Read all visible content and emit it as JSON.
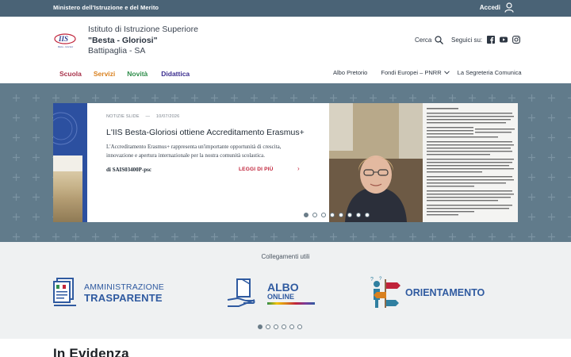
{
  "topbar": {
    "ministry": "Ministero dell'Istruzione e del Merito",
    "login_label": "Accedi"
  },
  "header": {
    "logo_text": "IIS",
    "logo_subtext": "Besta - Gloriosi",
    "school_line1": "Istituto di Istruzione Superiore",
    "school_line2": "\"Besta - Gloriosi\"",
    "school_line3": "Battipaglia - SA",
    "search_label": "Cerca",
    "social_label": "Seguici su:"
  },
  "nav": {
    "left": [
      {
        "label": "Scuola",
        "color": "#a8324a"
      },
      {
        "label": "Servizi",
        "color": "#d9801e"
      },
      {
        "label": "Novità",
        "color": "#2e8d4a"
      },
      {
        "label": "Didattica",
        "color": "#3a2d8f"
      }
    ],
    "right": [
      {
        "label": "Albo Pretorio"
      },
      {
        "label": "Fondi Europei – PNRR"
      },
      {
        "label": "La Segreteria Comunica"
      }
    ]
  },
  "hero": {
    "category": "NOTIZIE SLIDE",
    "separator": "—",
    "date": "10/07/2026",
    "title": "L'IIS Besta-Gloriosi ottiene Accreditamento Erasmus+",
    "text": "L'Accreditamento Erasmus+ rappresenta un'importante opportunità di crescita, innovazione e apertura internazionale per la nostra comunità scolastica.",
    "author": "di SAIS03400P-psc",
    "read_more": "LEGGI DI PIÙ",
    "slides_count": 8,
    "active_slide": 0
  },
  "links": {
    "title": "Collegamenti utili",
    "banners": [
      {
        "line1": "AMMINISTRAZIONE",
        "line2": "TRASPARENTE"
      },
      {
        "line1": "ALBO",
        "line2": "ONLINE"
      },
      {
        "line1": "ORIENTAMENTO"
      }
    ],
    "dots_count": 6,
    "active_dot": 0
  },
  "section": {
    "title": "In Evidenza"
  },
  "colors": {
    "topbar": "#4a6376",
    "hero_bg": "#617b8b",
    "accent_red": "#c0233a",
    "links_bg": "#eff1f2",
    "banner_blue": "#2f5aa0"
  }
}
